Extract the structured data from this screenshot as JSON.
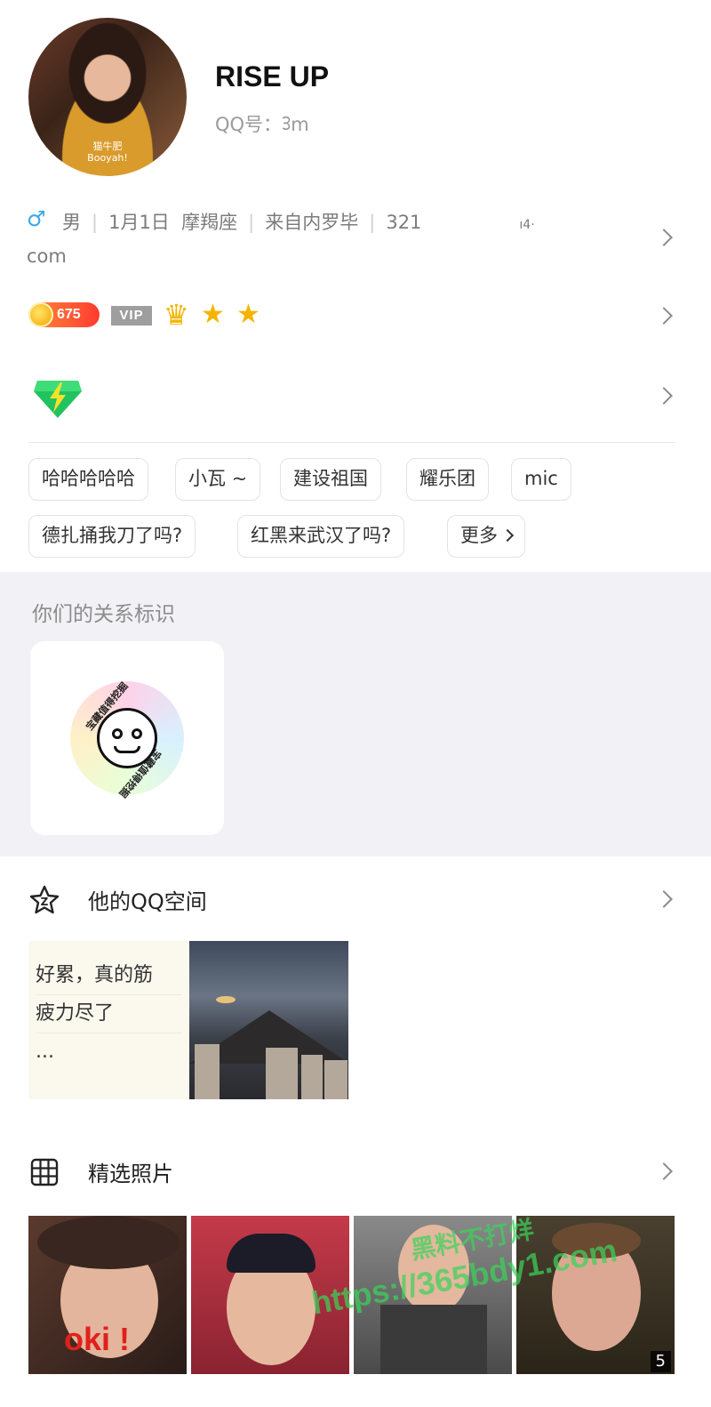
{
  "profile": {
    "nickname": "RISE UP",
    "qq_label": "QQ号：ᢃm",
    "avatar_caption_line1": "猫牛肥",
    "avatar_caption_line2": "Booyah!"
  },
  "info": {
    "gender": "男",
    "birthday": "1月1日",
    "zodiac": "摩羯座",
    "hometown": "来自内罗毕",
    "extra": "321",
    "extra_tail": "ı4·",
    "continuation": "com"
  },
  "badges": {
    "coin_count": "675",
    "vip_label": "VIP"
  },
  "tags": [
    {
      "label": "哈哈哈哈哈"
    },
    {
      "label": "小瓦 ~"
    },
    {
      "label": "建设祖国"
    },
    {
      "label": "耀乐团"
    },
    {
      "label": "mic"
    },
    {
      "label": "德扎捅我刀了吗?"
    },
    {
      "label": "红黑来武汉了吗?"
    },
    {
      "label": "更多"
    }
  ],
  "relation": {
    "title": "你们的关系标识",
    "ring_text": "宝藏值得挖掘"
  },
  "qzone": {
    "title": "他的QQ空间",
    "post_lines": [
      "好累，真的筋",
      "疲力尽了",
      "..."
    ]
  },
  "photos": {
    "title": "精选照片",
    "first_photo_text": "oki !",
    "count": "5"
  },
  "watermark": {
    "line1": "黑料不打烊",
    "line2": "https://365bdy1.com"
  },
  "colors": {
    "gender_blue": "#3aa6ea",
    "coin_red": "#ff3b2f",
    "gold": "#f5b400",
    "watermark_green": "#3cd25a"
  }
}
